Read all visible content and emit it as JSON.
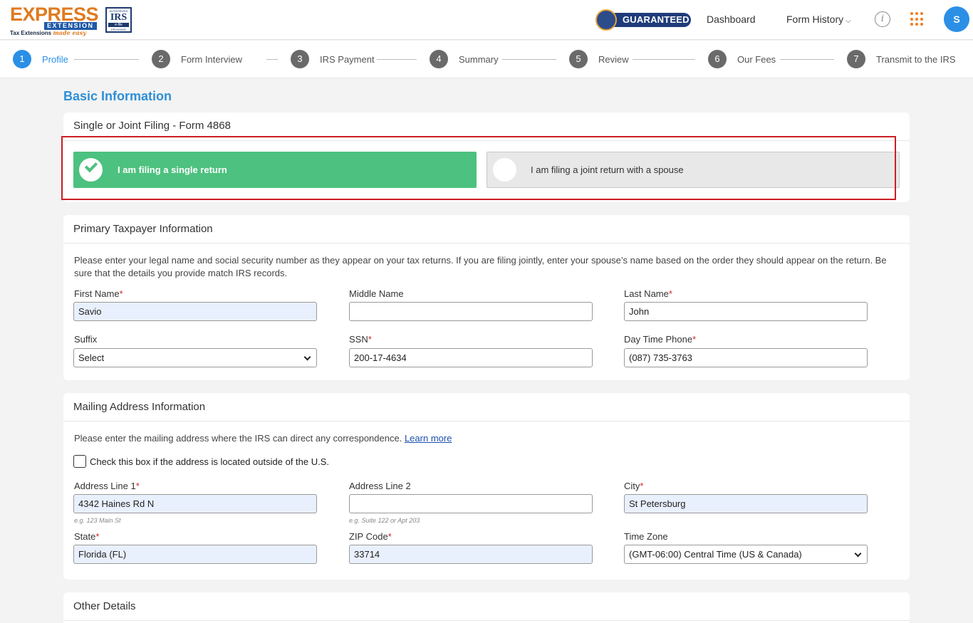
{
  "header": {
    "logo_text": "EXPRESS",
    "logo_sub": "EXTENSION",
    "logo_tag": "Tax Extensions",
    "logo_tag_script": "made easy",
    "irs_line1": "AUTHORIZED",
    "irs_line2": "IRS",
    "irs_line3": "e-file",
    "irs_line4": "PROVIDER",
    "guaranteed_label": "GUARANTEED",
    "nav_dashboard": "Dashboard",
    "nav_form_history": "Form History",
    "avatar_initial": "S"
  },
  "steps": [
    {
      "num": "1",
      "label": "Profile"
    },
    {
      "num": "2",
      "label": "Form Interview"
    },
    {
      "num": "3",
      "label": "IRS Payment"
    },
    {
      "num": "4",
      "label": "Summary"
    },
    {
      "num": "5",
      "label": "Review"
    },
    {
      "num": "6",
      "label": "Our Fees"
    },
    {
      "num": "7",
      "label": "Transmit to the IRS"
    }
  ],
  "section_title": "Basic Information",
  "filing": {
    "title": "Single or Joint Filing - Form 4868",
    "single_label": "I am filing a single return",
    "joint_label": "I am filing a joint return with a spouse"
  },
  "primary": {
    "title": "Primary Taxpayer Information",
    "description": "Please enter your legal name and social security number as they appear on your tax returns. If you are filing jointly, enter your spouse’s name based on the order they should appear on the return. Be sure that the details you provide match IRS records.",
    "first_name_label": "First Name",
    "first_name_value": "Savio",
    "middle_name_label": "Middle Name",
    "middle_name_value": "",
    "last_name_label": "Last Name",
    "last_name_value": "John",
    "suffix_label": "Suffix",
    "suffix_value": "Select",
    "ssn_label": "SSN",
    "ssn_value": "200-17-4634",
    "phone_label": "Day Time Phone",
    "phone_value": "(087) 735-3763"
  },
  "mailing": {
    "title": "Mailing Address Information",
    "description": "Please enter the mailing address where the IRS can direct any correspondence.",
    "learn_more": "Learn more",
    "outside_us_label": "Check this box if the address is located outside of the U.S.",
    "address1_label": "Address Line 1",
    "address1_value": "4342 Haines Rd N",
    "address1_hint": "e.g. 123 Main St",
    "address2_label": "Address Line 2",
    "address2_value": "",
    "address2_hint": "e.g. Suite 122 or Apt 203",
    "city_label": "City",
    "city_value": "St Petersburg",
    "state_label": "State",
    "state_value": "Florida (FL)",
    "zip_label": "ZIP Code",
    "zip_value": "33714",
    "timezone_label": "Time Zone",
    "timezone_value": "(GMT-06:00) Central Time (US & Canada)"
  },
  "other": {
    "title": "Other Details"
  },
  "required_mark": "*",
  "colors": {
    "accent_blue": "#2b8fe6",
    "success_green": "#4dc17f",
    "highlight_red": "#cc1f24",
    "brand_orange": "#f07d22"
  }
}
